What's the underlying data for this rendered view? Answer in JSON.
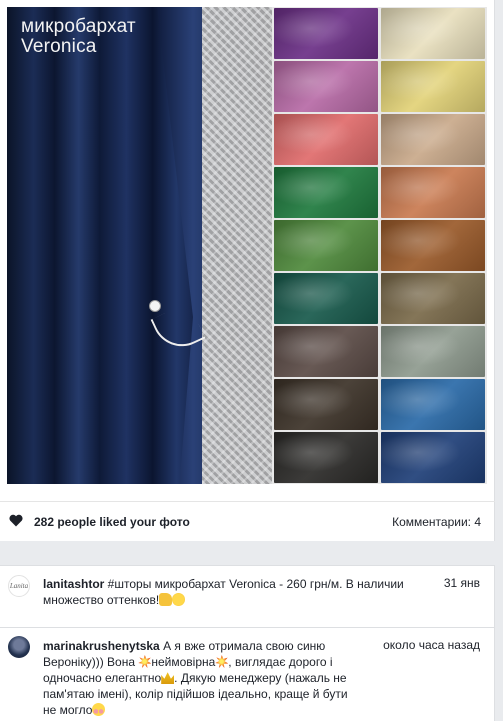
{
  "post": {
    "photo_title_line1": "микробархат",
    "photo_title_line2": "Veronica",
    "swatch_colors": [
      "#6b2f86",
      "#e8dfbd",
      "#b76aa6",
      "#e2d277",
      "#e06b6b",
      "#c9a98a",
      "#1f7a3e",
      "#c97a50",
      "#4f8a3c",
      "#9a5a2a",
      "#185a4c",
      "#7a6a4a",
      "#5b4b46",
      "#8e9a8e",
      "#3c3228",
      "#2a6aa8",
      "#2b2a28",
      "#1f3f78"
    ]
  },
  "likes_bar": {
    "likes_text": "282 people liked your фото",
    "comments_label": "Комментарии: 4"
  },
  "comments": [
    {
      "avatar_text": "Lanita",
      "author": "lanitashtor",
      "text_part1": " #шторы микробархат Veronica - 260 грн/м. В наличии множество оттенков!",
      "emojis": [
        "thumbs-up-icon",
        "grinning-face-icon"
      ],
      "time": "31 янв"
    },
    {
      "author": "marinakrushenytska",
      "text_part1": " А я вже отримала свою синю Вероніку))) Вона ",
      "text_part2": "неймовірна",
      "text_part3": ", виглядає дорого і одночасно елегантно",
      "text_part4": ". Дякую менеджеру (нажаль не пам'ятаю імені), колір підійшов ідеально, краще й бути не могло",
      "emojis": [
        "collision-icon",
        "crown-icon",
        "smiling-blush-icon"
      ],
      "time": "около часа назад"
    }
  ],
  "colors": {
    "page_background": "#e9ebee",
    "card_background": "#ffffff",
    "text": "#1d2129"
  }
}
